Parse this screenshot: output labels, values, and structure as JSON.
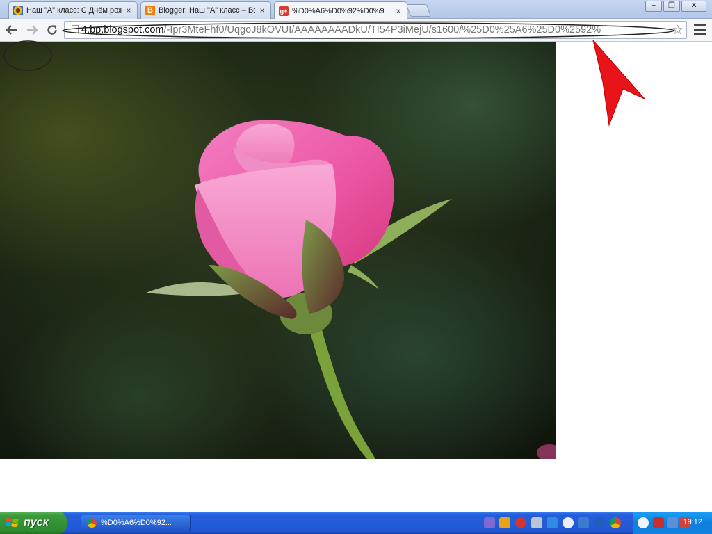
{
  "browser": {
    "tabs": [
      {
        "title": "Наш \"А\" класс: С Днём рож",
        "close": "×"
      },
      {
        "title": "Blogger: Наш \"А\" класс – Во",
        "close": "×"
      },
      {
        "title": "%D0%A6%D0%92%D0%9",
        "close": "×"
      }
    ],
    "url": {
      "prefix": "",
      "host": "4.bp.blogspot.com",
      "path": "/-Ipr3MteFhf0/UqgoJ8kOVUI/AAAAAAAADkU/TI54P3iMejU/s1600/%25D0%25A6%25D0%2592%"
    },
    "window_controls": {
      "minimize": "−",
      "maximize": "❐",
      "close": "✕"
    }
  },
  "page": {
    "image": {
      "name": "pink rose bud photo"
    }
  },
  "taskbar": {
    "start_label": "пуск",
    "task_label": "%D0%A6%D0%92...",
    "clock": "19:12"
  },
  "annotations": {
    "arrow_color": "#e8141a",
    "ellipse_color": "#222222"
  },
  "icons": {
    "back": "back-arrow-icon",
    "forward": "forward-arrow-icon",
    "reload": "reload-icon",
    "star": "bookmark-star-icon",
    "menu": "chrome-menu-icon"
  }
}
